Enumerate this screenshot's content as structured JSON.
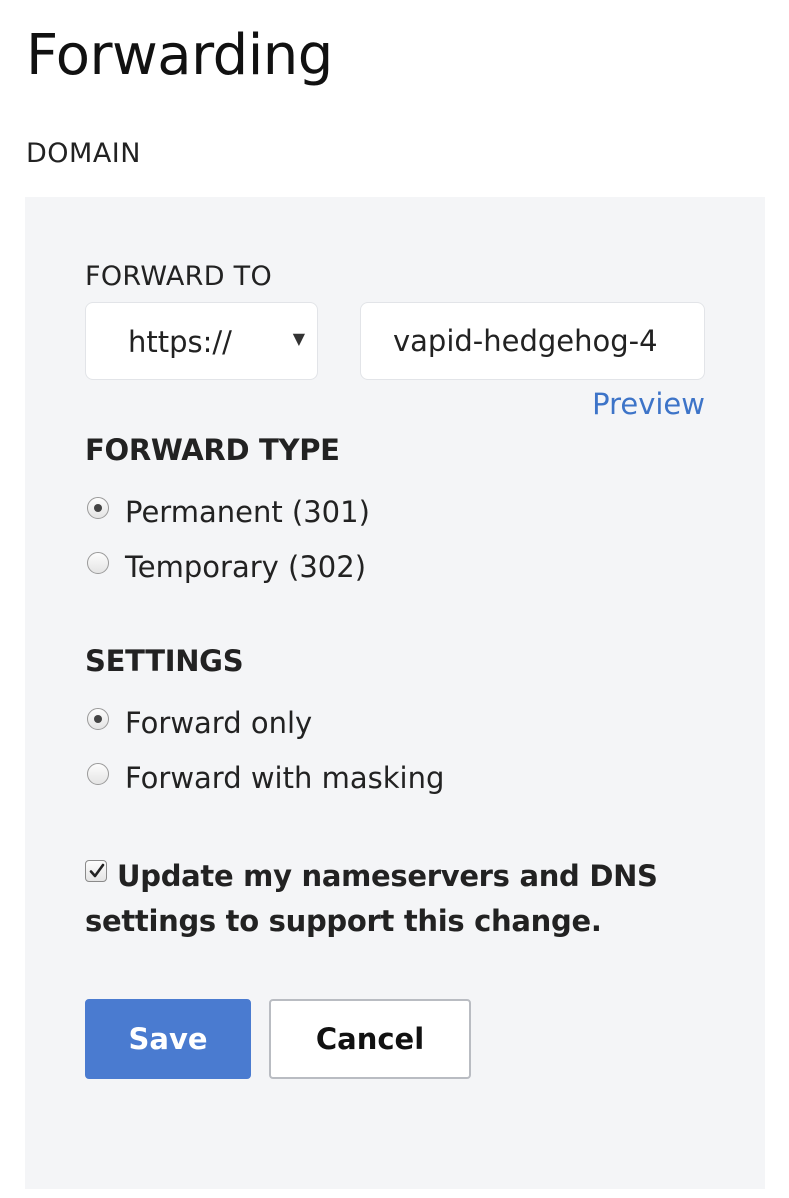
{
  "page": {
    "title": "Forwarding",
    "section_label": "DOMAIN"
  },
  "forward_to": {
    "label": "FORWARD TO",
    "protocol": {
      "selected": "https://",
      "caret_icon": "caret-down-icon"
    },
    "domain_input": {
      "value": "vapid-hedgehog-4"
    },
    "preview_label": "Preview",
    "link_color": "#3d74c8"
  },
  "forward_type": {
    "heading": "FORWARD TYPE",
    "options": [
      {
        "label": "Permanent (301)",
        "checked": true
      },
      {
        "label": "Temporary (302)",
        "checked": false
      }
    ]
  },
  "settings": {
    "heading": "SETTINGS",
    "options": [
      {
        "label": "Forward only",
        "checked": true
      },
      {
        "label": "Forward with masking",
        "checked": false
      }
    ]
  },
  "dns_update": {
    "checked": true,
    "label": "Update my nameservers and DNS settings to support this change."
  },
  "actions": {
    "save_label": "Save",
    "cancel_label": "Cancel",
    "primary_color": "#4a7bd0"
  }
}
